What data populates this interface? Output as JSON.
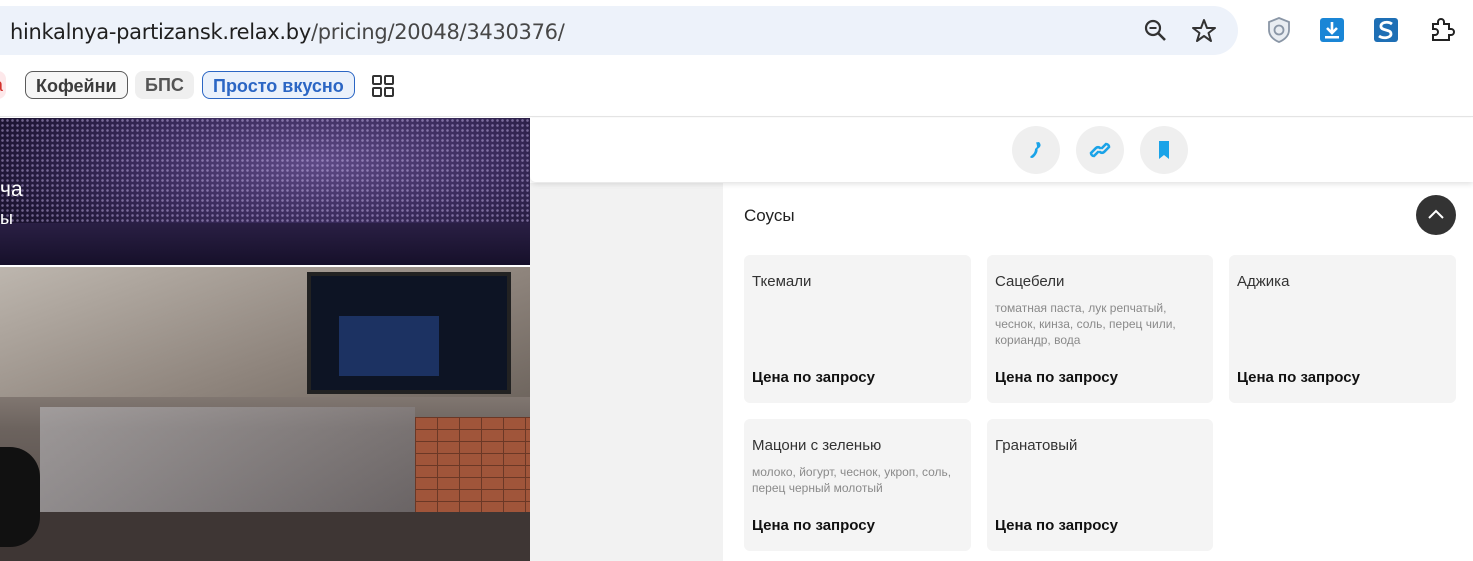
{
  "browser": {
    "url_host": "hinkalnya-partizansk.relax.by",
    "url_path": "/pricing/20048/3430376/",
    "icons": [
      "zoom-icon",
      "bookmark-star-icon",
      "shield-extension-icon",
      "download-extension-icon",
      "s-extension-icon",
      "extensions-puzzle-icon"
    ]
  },
  "chips": {
    "partial": "а",
    "cafe": "Кофейни",
    "bps": "БПС",
    "simple": "Просто вкусно"
  },
  "photos": {
    "line1": "ча",
    "line2": "ы"
  },
  "actions": [
    "phone-icon",
    "link-icon",
    "bookmark-icon"
  ],
  "section": {
    "title": "Соусы",
    "items": [
      {
        "name": "Ткемали",
        "desc": "",
        "price": "Цена по запросу"
      },
      {
        "name": "Сацебели",
        "desc": "томатная паста, лук репчатый, чеснок, кинза, соль, перец чили, кориандр, вода",
        "price": "Цена по запросу"
      },
      {
        "name": "Аджика",
        "desc": "",
        "price": "Цена по запросу"
      },
      {
        "name": "Мацони с зеленью",
        "desc": "молоко, йогурт, чеснок, укроп, соль, перец черный молотый",
        "price": "Цена по запросу"
      },
      {
        "name": "Гранатовый",
        "desc": "",
        "price": "Цена по запросу"
      }
    ]
  },
  "colors": {
    "accent": "#1aa3e8",
    "chip_blue": "#2b66c4",
    "collapse_bg": "#333333"
  }
}
